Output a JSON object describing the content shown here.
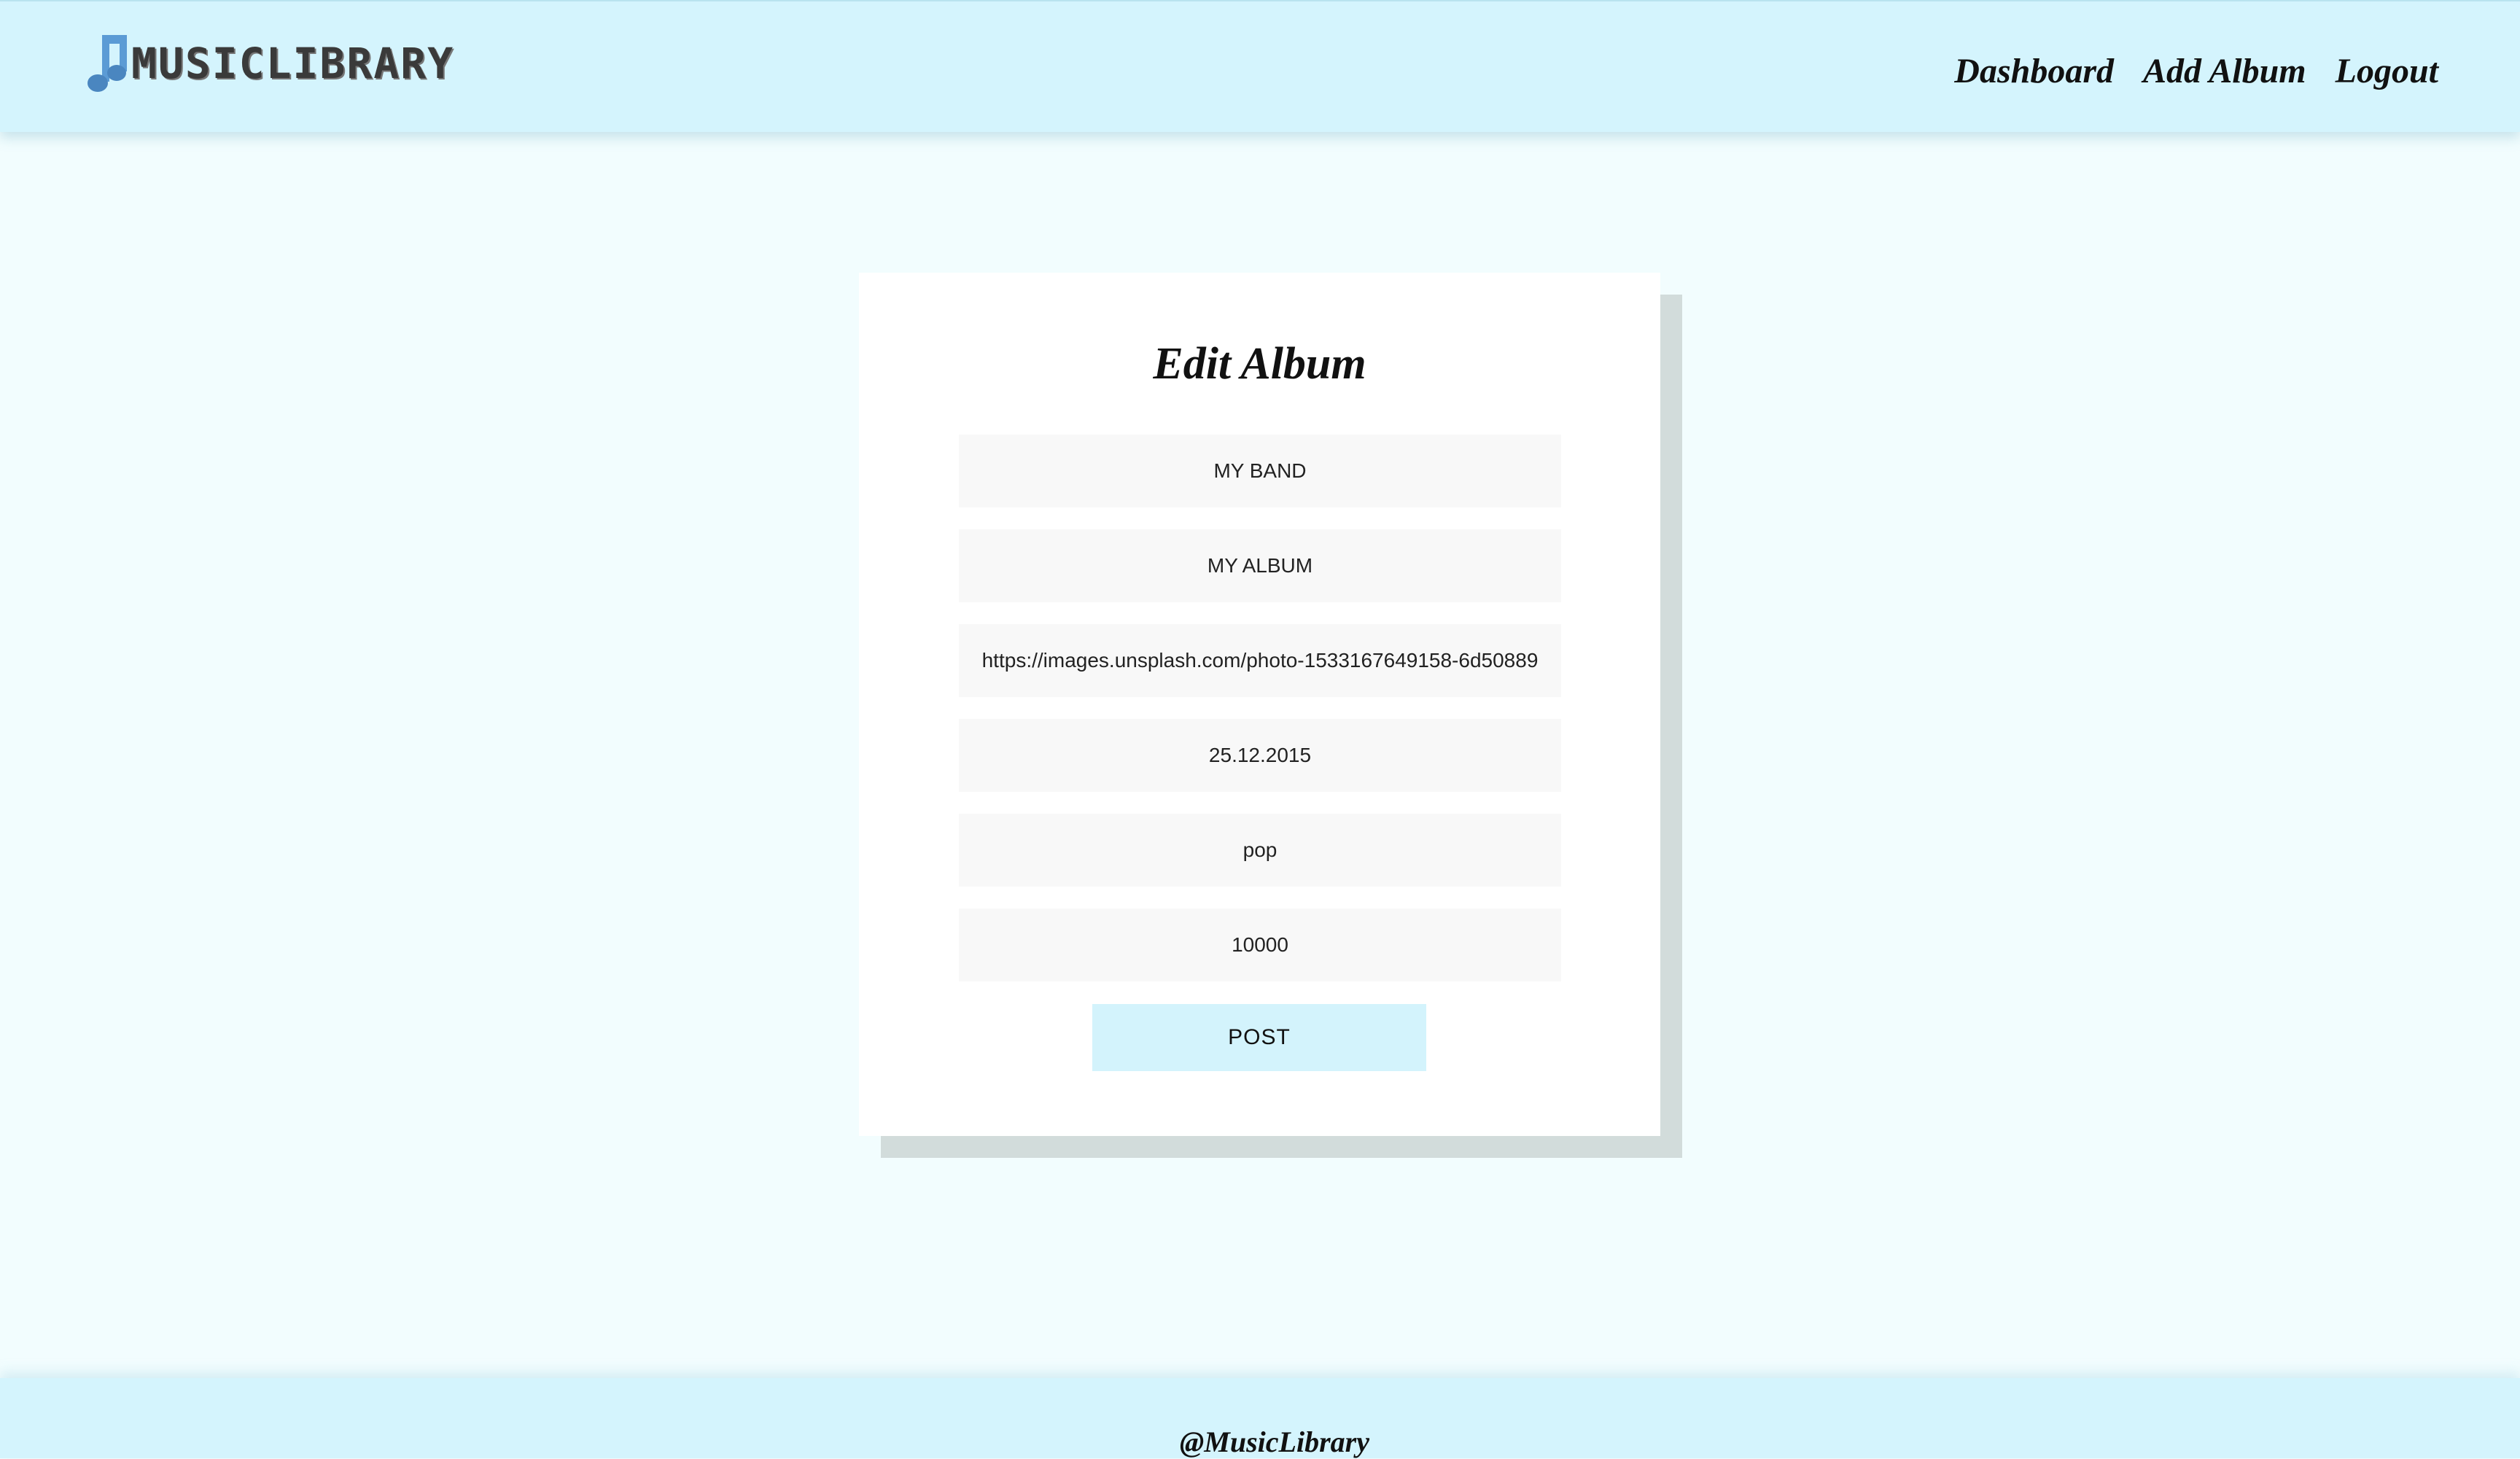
{
  "header": {
    "logo_text": "MUSICLIBRARY",
    "logo_icon": "music-note-icon",
    "nav": {
      "dashboard": "Dashboard",
      "add_album": "Add Album",
      "logout": "Logout"
    }
  },
  "form": {
    "title": "Edit Album",
    "fields": {
      "band": "MY BAND",
      "album": "MY ALBUM",
      "image_url": "https://images.unsplash.com/photo-1533167649158-6d50889",
      "release_date": "25.12.2015",
      "genre": "pop",
      "sales": "10000"
    },
    "submit_label": "POST"
  },
  "footer": {
    "text": "@MusicLibrary"
  },
  "colors": {
    "header_bg": "#d4f4fd",
    "page_bg": "#f2fdfe",
    "card_shadow": "#d2dcdb",
    "button_bg": "#d3f3fc",
    "logo_note": "#5b9bd5"
  }
}
